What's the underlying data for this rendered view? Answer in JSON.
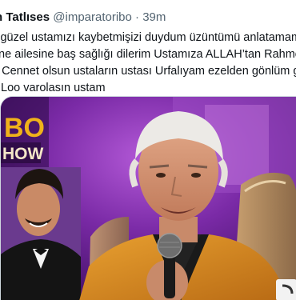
{
  "tweet": {
    "author_name": "n Tatlıses",
    "author_handle": "@imparatoribo",
    "separator": "·",
    "time": "39m",
    "lines": [
      "sigüzel ustamızı kaybetmişizi duydum üzüntümü anlatamam",
      "rine ailesine baş sağlığı dilerim Ustamıza ALLAH’tan Rahmet",
      "n Cennet olsun ustaların ustası Urfalıyam ezelden gönlüm ge",
      "Loo varolasın ustam"
    ]
  },
  "media": {
    "show_logo_line1": "BO",
    "show_logo_line2": "HOW"
  },
  "colors": {
    "text": "#0f1419",
    "secondary": "#536471",
    "show_logo": "#f0b21a",
    "studio_purple": "#5a1a8a"
  }
}
